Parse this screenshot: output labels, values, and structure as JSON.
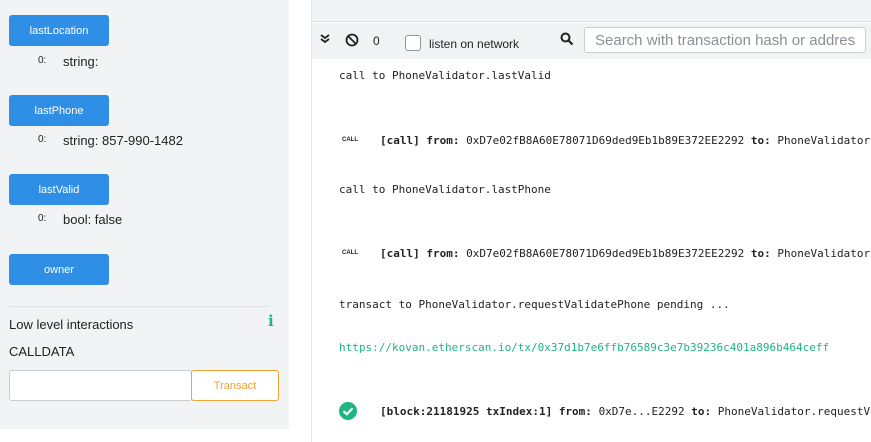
{
  "functions": [
    {
      "label": "lastLocation",
      "index": "0:",
      "value": "string:"
    },
    {
      "label": "lastPhone",
      "index": "0:",
      "value": "string: 857-990-1482"
    },
    {
      "label": "lastValid",
      "index": "0:",
      "value": "bool: false"
    },
    {
      "label": "owner"
    }
  ],
  "low_level": {
    "title": "Low level interactions",
    "calldata_label": "CALLDATA",
    "calldata_value": "",
    "transact_label": "Transact"
  },
  "terminal": {
    "pending_count": "0",
    "listen_label": "listen on network",
    "search_placeholder": "Search with transaction hash or address",
    "entries": {
      "call1": "call to PhoneValidator.lastValid",
      "badge": "CALL",
      "call_tag": "[call]",
      "from_label": "from:",
      "from_addr": "0xD7e02fB8A60E78071D69ded9Eb1b89E372EE2292",
      "to_label": "to:",
      "to_value": "PhoneValidator.lastValid()",
      "to_value2": "PhoneValidator.lastPhone()",
      "call2": "call to PhoneValidator.lastPhone",
      "transact": "transact to PhoneValidator.requestValidatePhone pending ...",
      "link": "https://kovan.etherscan.io/tx/0x37d1b7e6ffb76589c3e7b39236c401a896b464ceff",
      "block_tag": "[block:21181925 txIndex:1]",
      "from_short": "0xD7e...E2292",
      "to_value3": "PhoneValidator.requestValidatePhone"
    }
  },
  "colors": {
    "primary": "#2f8fe6",
    "warning": "#f0a233",
    "success": "#1fb582"
  }
}
